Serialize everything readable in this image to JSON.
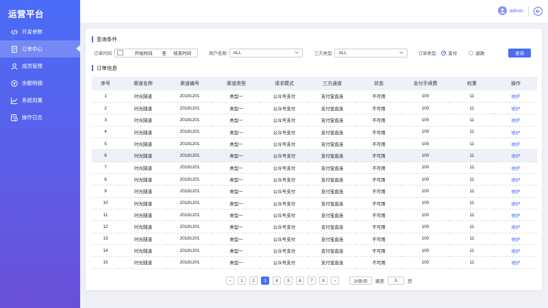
{
  "app": {
    "title": "运营平台"
  },
  "sidebar": {
    "items": [
      {
        "label": "开发参数",
        "icon": "code-icon"
      },
      {
        "label": "订单中心",
        "icon": "document-icon",
        "active": true
      },
      {
        "label": "成员管理",
        "icon": "user-icon"
      },
      {
        "label": "余额明细",
        "icon": "coin-icon"
      },
      {
        "label": "系统用量",
        "icon": "line-chart-icon"
      },
      {
        "label": "操作日志",
        "icon": "log-icon"
      }
    ]
  },
  "topbar": {
    "username": "admin",
    "logout_icon": "logout-icon"
  },
  "query": {
    "title": "查询条件",
    "order_time_label": "订单时间:",
    "start_placeholder": "开始时间",
    "range_sep": "至",
    "end_placeholder": "结束时间",
    "merchant_label": "商户名称:",
    "merchant_value": "ALL",
    "third_party_label": "三方类型:",
    "third_party_value": "ALL",
    "order_type_label": "订单类型:",
    "order_type_options": [
      "支付",
      "退款"
    ],
    "order_type_selected": "支付",
    "search_label": "查询"
  },
  "orders": {
    "title": "订单信息",
    "columns": [
      "序号",
      "渠道名称",
      "渠道编号",
      "渠道类型",
      "请求模式",
      "三方通道",
      "状态",
      "支付手续费",
      "权重",
      "操作"
    ],
    "rows": [
      [
        "1",
        "时光隧道",
        "20181201",
        "类型一",
        "公众号支付",
        "支付宝直连",
        "不可用",
        "100",
        "11",
        "维护"
      ],
      [
        "2",
        "时光隧道",
        "20181201",
        "类型一",
        "公众号支付",
        "支付宝直连",
        "不可用",
        "100",
        "11",
        "维护"
      ],
      [
        "3",
        "时光隧道",
        "20181201",
        "类型一",
        "公众号支付",
        "支付宝直连",
        "不可用",
        "100",
        "11",
        "维护"
      ],
      [
        "4",
        "时光隧道",
        "20181201",
        "类型一",
        "公众号支付",
        "支付宝直连",
        "不可用",
        "100",
        "11",
        "维护"
      ],
      [
        "5",
        "时光隧道",
        "20181201",
        "类型一",
        "公众号支付",
        "支付宝直连",
        "不可用",
        "100",
        "11",
        "维护"
      ],
      [
        "6",
        "时光隧道",
        "20181201",
        "类型一",
        "公众号支付",
        "支付宝直连",
        "不可用",
        "100",
        "11",
        "维护"
      ],
      [
        "7",
        "时光隧道",
        "20181201",
        "类型一",
        "公众号支付",
        "支付宝直连",
        "不可用",
        "100",
        "11",
        "维护"
      ],
      [
        "8",
        "时光隧道",
        "20181201",
        "类型一",
        "公众号支付",
        "支付宝直连",
        "不可用",
        "100",
        "11",
        "维护"
      ],
      [
        "9",
        "时光隧道",
        "20181201",
        "类型一",
        "公众号支付",
        "支付宝直连",
        "不可用",
        "100",
        "11",
        "维护"
      ],
      [
        "10",
        "时光隧道",
        "20181201",
        "类型一",
        "公众号支付",
        "支付宝直连",
        "不可用",
        "100",
        "11",
        "维护"
      ],
      [
        "11",
        "时光隧道",
        "20181201",
        "类型一",
        "公众号支付",
        "支付宝直连",
        "不可用",
        "100",
        "11",
        "维护"
      ],
      [
        "12",
        "时光隧道",
        "20181201",
        "类型一",
        "公众号支付",
        "支付宝直连",
        "不可用",
        "100",
        "11",
        "维护"
      ],
      [
        "13",
        "时光隧道",
        "20181201",
        "类型一",
        "公众号支付",
        "支付宝直连",
        "不可用",
        "100",
        "11",
        "维护"
      ],
      [
        "14",
        "时光隧道",
        "20181201",
        "类型一",
        "公众号支付",
        "支付宝直连",
        "不可用",
        "100",
        "11",
        "维护"
      ],
      [
        "15",
        "时光隧道",
        "20181201",
        "类型一",
        "公众号支付",
        "支付宝直连",
        "不可用",
        "100",
        "11",
        "维护"
      ]
    ],
    "highlighted_row": 6
  },
  "pagination": {
    "prev": "‹",
    "next": "›",
    "pages": [
      "1",
      "2",
      "3",
      "4",
      "5",
      "6",
      "7",
      "8"
    ],
    "current": "3",
    "page_size": "20条/页",
    "jump_label": "跳至",
    "jump_value": "5",
    "page_unit": "页"
  },
  "colors": {
    "accent": "#4a6cf7",
    "sidebar_top": "#4a6cf7",
    "sidebar_bottom": "#6a4fd8",
    "row_highlight": "#eef1f7"
  }
}
